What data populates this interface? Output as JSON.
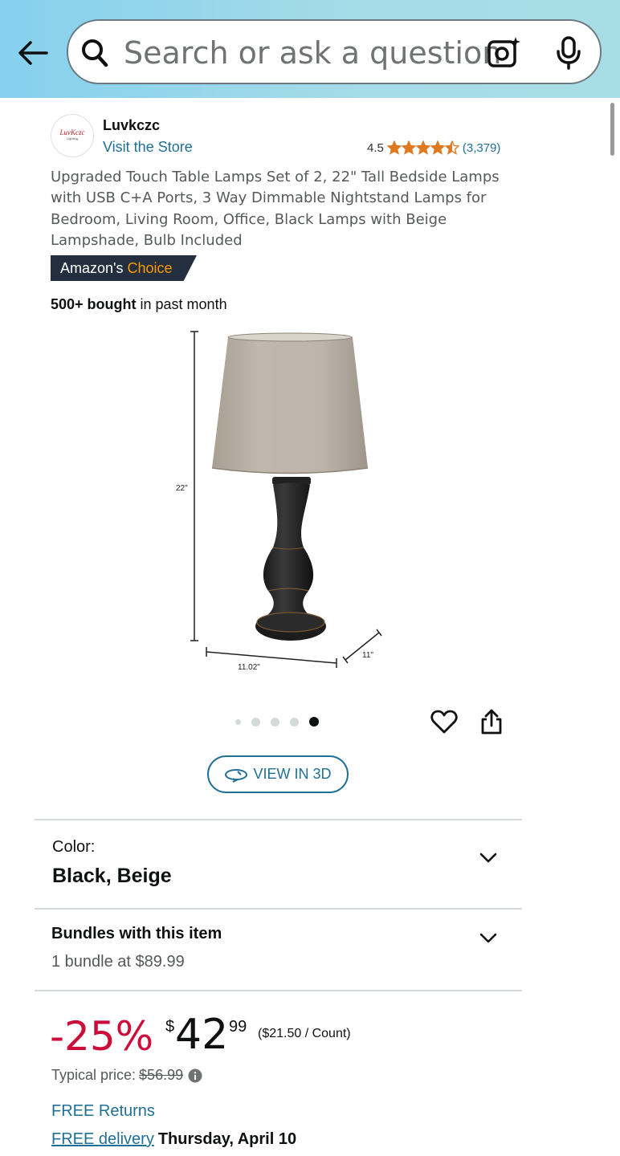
{
  "header": {
    "search_placeholder": "Search or ask a question"
  },
  "brand": {
    "logo_text": "LuvKczc",
    "logo_subtext": "Lighting",
    "name": "Luvkczc",
    "store_link": "Visit the Store"
  },
  "rating": {
    "value": "4.5",
    "stars": 4.5,
    "count": "(3,379)",
    "star_color": "#de7921"
  },
  "product": {
    "title": "Upgraded Touch Table Lamps Set of 2, 22\" Tall Bedside Lamps with USB C+A Ports, 3 Way Dimmable Nightstand Lamps for Bedroom, Living Room, Office, Black Lamps with Beige Lampshade, Bulb Included",
    "badge_prefix": "Amazon's",
    "badge_accent": "Choice",
    "bought_bold": "500+ bought",
    "bought_rest": " in past month",
    "image": {
      "height_label": "22\"",
      "width_label": "11.02\"",
      "depth_label": "11\""
    }
  },
  "carousel": {
    "count": 5,
    "active_index": 4
  },
  "view3d": {
    "label": "VIEW IN 3D"
  },
  "color_section": {
    "label": "Color:",
    "value": "Black, Beige"
  },
  "bundles_section": {
    "title": "Bundles with this item",
    "subtitle": "1 bundle at $89.99"
  },
  "price": {
    "discount": "-25%",
    "currency_symbol": "$",
    "whole": "42",
    "fraction": "99",
    "unit_price": "($21.50 / Count)",
    "typical_label": "Typical price:",
    "typical_value": "$56.99",
    "discount_color": "#cc0c39"
  },
  "shipping": {
    "free_returns": "FREE Returns",
    "free_delivery": "FREE delivery",
    "delivery_date": "Thursday, April 10"
  },
  "colors": {
    "link": "#1f6f96",
    "badge_bg": "#232f3e",
    "badge_accent": "#ff9900"
  }
}
